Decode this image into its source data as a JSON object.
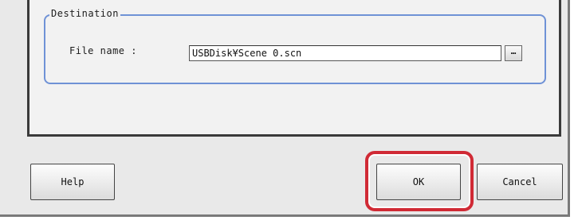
{
  "destination": {
    "group_title": "Destination",
    "file_name_label": "File name :",
    "file_name_value": "USBDisk¥Scene 0.scn",
    "browse_label": "…"
  },
  "buttons": {
    "help": "Help",
    "ok": "OK",
    "cancel": "Cancel"
  },
  "colors": {
    "group_border": "#6f92d6",
    "highlight": "#d02a35"
  },
  "icons": {
    "browse": "ellipsis-icon"
  }
}
